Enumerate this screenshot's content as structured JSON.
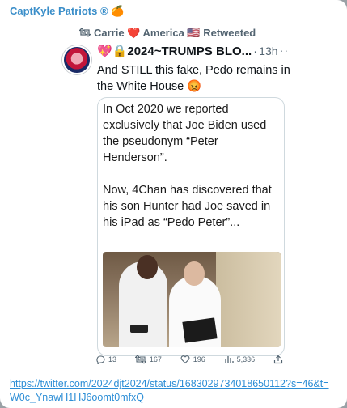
{
  "channel": {
    "name": "CaptKyle Patriots ® 🍊"
  },
  "tweet": {
    "retweet_label": "Carrie ❤️ America 🇺🇸 Retweeted",
    "author": "💖🔒2024~TRUMPS BLO...",
    "time": "13h",
    "text": "And STILL this fake, Pedo remains in the White House 😡",
    "card_text": "In Oct 2020 we reported exclusively that Joe Biden used the pseudonym “Peter Henderson”.\n\nNow, 4Chan has discovered that his son Hunter had Joe saved in his iPad as “Pedo Peter”...",
    "stats": {
      "replies": "13",
      "retweets": "167",
      "likes": "196",
      "views": "5,336"
    }
  },
  "link": {
    "url": "https://twitter.com/2024djt2024/status/1683029734018650112?s=46&t=W0c_YnawH1HJ6oomt0mfxQ"
  },
  "colors": {
    "link": "#2d8ed6",
    "channel_name": "#3a8ec9"
  }
}
